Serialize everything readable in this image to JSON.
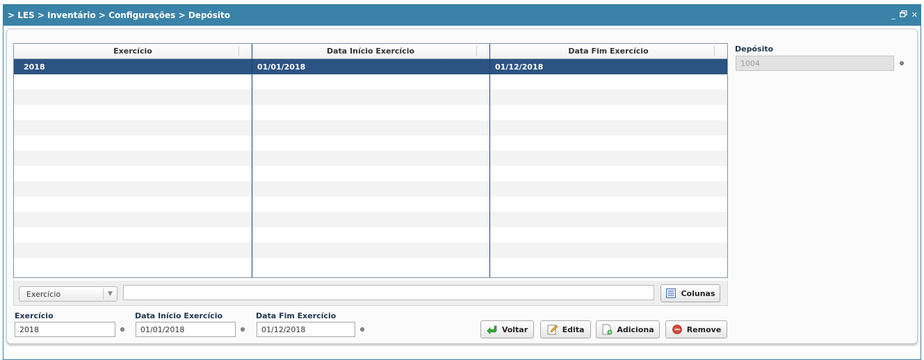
{
  "window": {
    "breadcrumb": "> LES > Inventário > Configurações > Depósito",
    "minimize_glyph": "_",
    "restore_glyph": "🗗",
    "close_glyph": "✕"
  },
  "grid": {
    "columns": [
      "Exercício",
      "Data Início Exercício",
      "Data Fim Exercício"
    ],
    "rows": [
      {
        "exercicio": "2018",
        "inicio": "01/01/2018",
        "fim": "01/12/2018",
        "selected": true
      }
    ]
  },
  "filter": {
    "selected_column": "Exercício",
    "search_value": "",
    "columns_button": "Colunas"
  },
  "form": {
    "exercicio_label": "Exercício",
    "exercicio_value": "2018",
    "inicio_label": "Data Início Exercício",
    "inicio_value": "01/01/2018",
    "fim_label": "Data Fim Exercício",
    "fim_value": "01/12/2018",
    "deposito_label": "Depósito",
    "deposito_value": "1004"
  },
  "actions": {
    "voltar": "Voltar",
    "edita": "Edita",
    "adiciona": "Adiciona",
    "remove": "Remove"
  },
  "colors": {
    "titlebar": "#3a82a8",
    "selected_row": "#2c5482",
    "remove_icon": "#e24a3c",
    "voltar_icon": "#3aa53a"
  }
}
